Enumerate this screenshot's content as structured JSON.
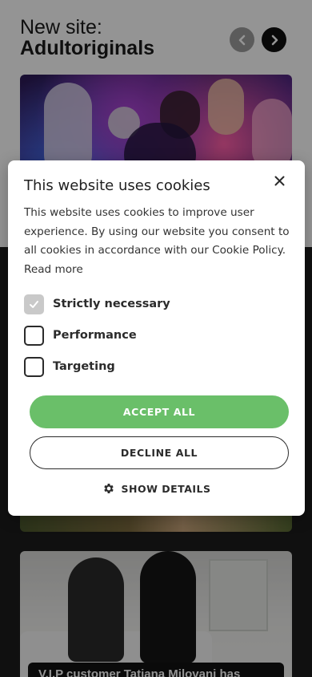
{
  "site": {
    "heading_line1": "New site:",
    "heading_line2": "Adultoriginals",
    "prev_icon": "chevron-left-icon",
    "next_icon": "chevron-right-icon",
    "card3_caption": "V.I.P customer Tatiana Milovani has"
  },
  "cookie": {
    "title": "This website uses cookies",
    "body": "This website uses cookies to improve user experience. By using our website you consent to all cookies in accordance with our Cookie Policy.",
    "read_more": "Read more",
    "options": [
      {
        "label": "Strictly necessary",
        "checked": true
      },
      {
        "label": "Performance",
        "checked": false
      },
      {
        "label": "Targeting",
        "checked": false
      }
    ],
    "accept_label": "ACCEPT ALL",
    "decline_label": "DECLINE ALL",
    "details_label": "SHOW DETAILS",
    "details_icon": "gear-icon",
    "close_icon": "close-icon"
  },
  "colors": {
    "accept": "#6abf69",
    "checked_box": "#c9c9c9",
    "prev_button": "#9e9e9e",
    "next_button": "#111111"
  }
}
